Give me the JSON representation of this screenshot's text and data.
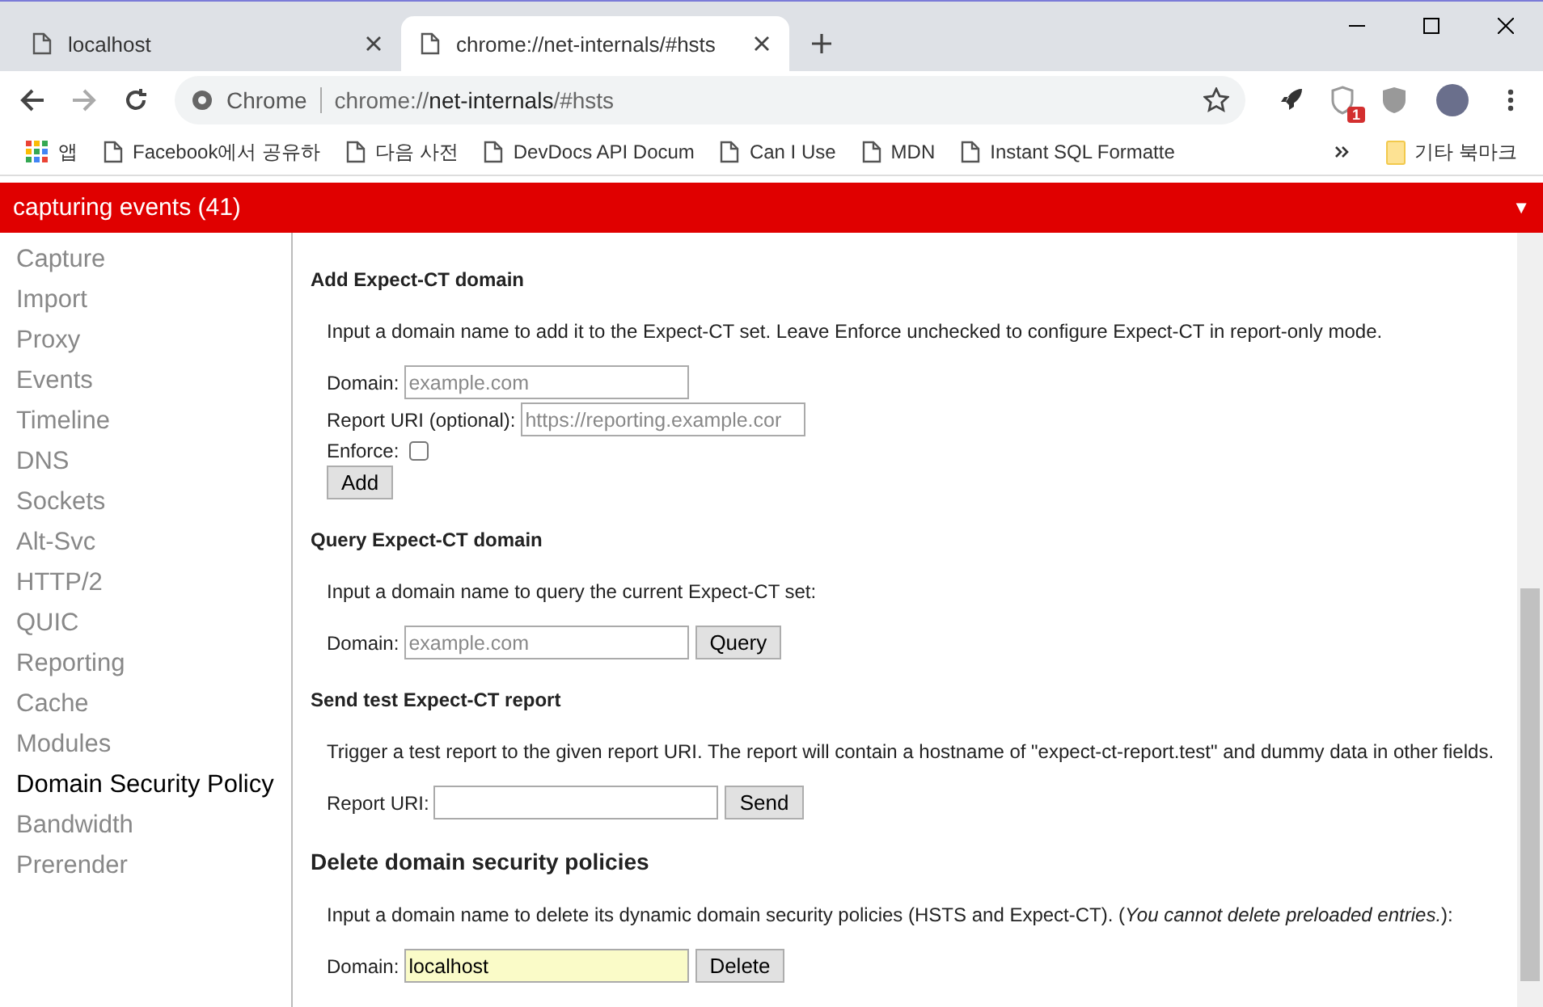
{
  "browser": {
    "tabs": [
      {
        "title": "localhost",
        "selected": false
      },
      {
        "title": "chrome://net-internals/#hsts",
        "selected": true
      }
    ],
    "address": {
      "site": "Chrome",
      "scheme": "chrome://",
      "host": "net-internals",
      "path": "/#hsts"
    },
    "extension_badge": "1",
    "bookmarks": [
      {
        "label": "앱",
        "kind": "apps"
      },
      {
        "label": "Facebook에서 공유하",
        "kind": "page"
      },
      {
        "label": "다음 사전",
        "kind": "page"
      },
      {
        "label": "DevDocs API Docum",
        "kind": "page"
      },
      {
        "label": "Can I Use",
        "kind": "page"
      },
      {
        "label": "MDN",
        "kind": "page"
      },
      {
        "label": "Instant SQL Formatte",
        "kind": "page"
      }
    ],
    "other_bookmarks": "기타 북마크"
  },
  "status_bar": {
    "text": "capturing events (41)",
    "caret": "▼"
  },
  "sidebar": {
    "items": [
      {
        "label": "Capture",
        "selected": false
      },
      {
        "label": "Import",
        "selected": false
      },
      {
        "label": "Proxy",
        "selected": false
      },
      {
        "label": "Events",
        "selected": false
      },
      {
        "label": "Timeline",
        "selected": false
      },
      {
        "label": "DNS",
        "selected": false
      },
      {
        "label": "Sockets",
        "selected": false
      },
      {
        "label": "Alt-Svc",
        "selected": false
      },
      {
        "label": "HTTP/2",
        "selected": false
      },
      {
        "label": "QUIC",
        "selected": false
      },
      {
        "label": "Reporting",
        "selected": false
      },
      {
        "label": "Cache",
        "selected": false
      },
      {
        "label": "Modules",
        "selected": false
      },
      {
        "label": "Domain Security Policy",
        "selected": true
      },
      {
        "label": "Bandwidth",
        "selected": false
      },
      {
        "label": "Prerender",
        "selected": false
      }
    ]
  },
  "sections": [
    {
      "title": "Add Expect-CT domain",
      "large": false,
      "description": "Input a domain name to add it to the Expect-CT set. Leave Enforce unchecked to configure Expect-CT in report-only mode.",
      "fields": [
        {
          "kind": "text",
          "label": "Domain:",
          "placeholder": "example.com"
        },
        {
          "kind": "text",
          "label": "Report URI (optional):",
          "placeholder": "https://reporting.example.cor"
        },
        {
          "kind": "checkbox",
          "label": "Enforce:",
          "checked": false
        }
      ],
      "button": "Add"
    },
    {
      "title": "Query Expect-CT domain",
      "large": false,
      "description": "Input a domain name to query the current Expect-CT set:",
      "fields": [
        {
          "kind": "text",
          "label": "Domain:",
          "placeholder": "example.com"
        }
      ],
      "button": "Query"
    },
    {
      "title": "Send test Expect-CT report",
      "large": false,
      "description": "Trigger a test report to the given report URI. The report will contain a hostname of \"expect-ct-report.test\" and dummy data in other fields.",
      "fields": [
        {
          "kind": "text",
          "label": "Report URI:"
        }
      ],
      "button": "Send"
    },
    {
      "title": "Delete domain security policies",
      "large": true,
      "description": "Input a domain name to delete its dynamic domain security policies (HSTS and Expect-CT). (*You cannot delete preloaded entries.*):",
      "fields": [
        {
          "kind": "text",
          "label": "Domain:",
          "value": "localhost",
          "autofilled": true
        }
      ],
      "button": "Delete"
    }
  ]
}
